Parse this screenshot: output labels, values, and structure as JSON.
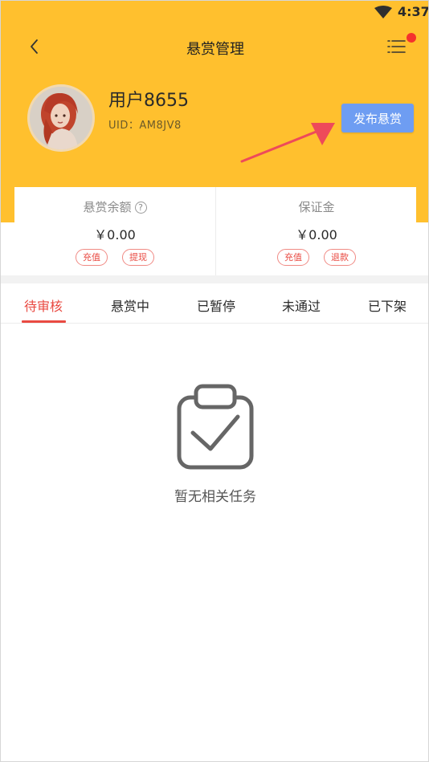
{
  "status_bar": {
    "time": "4:37",
    "wifi_icon": "wifi-icon"
  },
  "header": {
    "title": "悬赏管理",
    "back_icon": "chevron-left-icon",
    "menu_icon": "list-menu-icon",
    "has_notification_dot": true
  },
  "profile": {
    "username": "用户8655",
    "uid": "UID：AM8JV8",
    "publish_label": "发布悬赏"
  },
  "balance": {
    "reward_label": "悬赏余额",
    "reward_help": "?",
    "reward_amount": "￥0.00",
    "recharge_label": "充值",
    "withdraw_label": "提现",
    "deposit_label": "保证金",
    "deposit_amount": "￥0.00",
    "deposit_recharge_label": "充值",
    "refund_label": "退款"
  },
  "tabs": [
    {
      "label": "待审核",
      "active": true
    },
    {
      "label": "悬赏中",
      "active": false
    },
    {
      "label": "已暂停",
      "active": false
    },
    {
      "label": "未通过",
      "active": false
    },
    {
      "label": "已下架",
      "active": false
    }
  ],
  "empty_state": {
    "icon": "clipboard-check-icon",
    "text": "暂无相关任务"
  },
  "colors": {
    "brand_yellow": "#ffc02e",
    "accent_red": "#e94a42",
    "button_blue": "#6e9df2"
  }
}
